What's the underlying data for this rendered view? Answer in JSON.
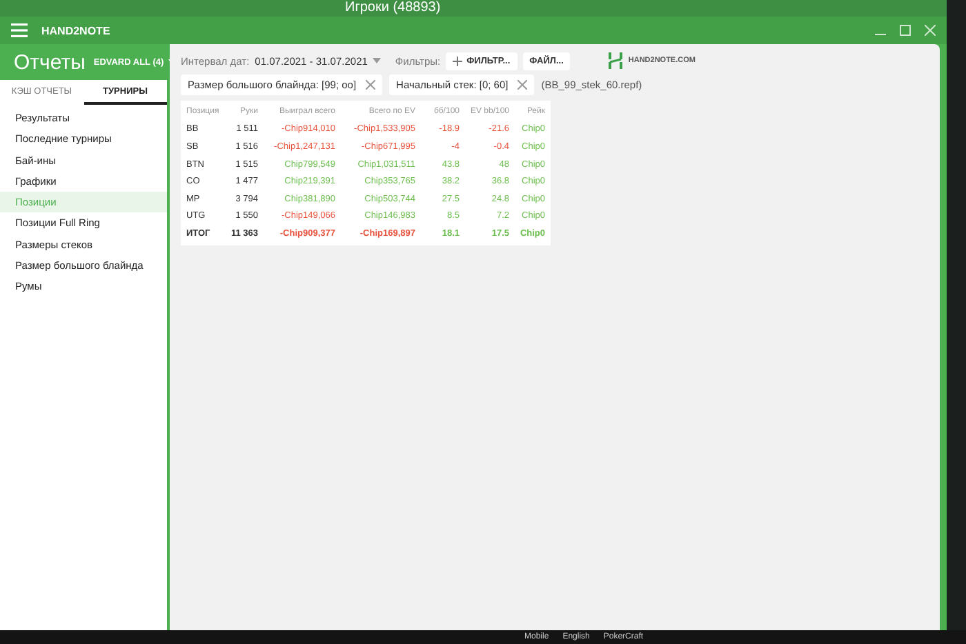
{
  "background_window": {
    "title": "Игроки (48893)"
  },
  "window": {
    "title": "HAND2NOTE"
  },
  "header": {
    "title": "Отчеты",
    "account": "EDVARD ALL (4)"
  },
  "tabs": [
    {
      "label": "КЭШ ОТЧЕТЫ",
      "selected": false
    },
    {
      "label": "ТУРНИРЫ",
      "selected": true
    }
  ],
  "sidebar": {
    "items": [
      {
        "label": "Результаты",
        "selected": false
      },
      {
        "label": "Последние турниры",
        "selected": false
      },
      {
        "label": "Бай-ины",
        "selected": false
      },
      {
        "label": "Графики",
        "selected": false
      },
      {
        "label": "Позиции",
        "selected": true
      },
      {
        "label": "Позиции Full Ring",
        "selected": false
      },
      {
        "label": "Размеры стеков",
        "selected": false
      },
      {
        "label": "Размер большого блайнда",
        "selected": false
      },
      {
        "label": "Румы",
        "selected": false
      }
    ]
  },
  "toolbar": {
    "date_label": "Интервал дат:",
    "date_value": "01.07.2021 - 31.07.2021",
    "filters_label": "Фильтры:",
    "filter_button": "ФИЛЬТР...",
    "file_button": "ФАЙЛ...",
    "logo_text": "HAND2NOTE.COM"
  },
  "active_filters": [
    {
      "label": "Размер большого блайнда: [99; oo]"
    },
    {
      "label": "Начальный стек: [0; 60]"
    }
  ],
  "filter_file": "(BB_99_stek_60.repf)",
  "table": {
    "columns": [
      "Позиция",
      "Руки",
      "Выиграл всего",
      "Всего по EV",
      "бб/100",
      "EV bb/100",
      "Рейк"
    ],
    "rows": [
      {
        "kind": "row",
        "cells": [
          {
            "text": "BB"
          },
          {
            "text": "1 511"
          },
          {
            "text": "-Chip914,010",
            "color": "#e8533c"
          },
          {
            "text": "-Chip1,533,905",
            "color": "#e8533c"
          },
          {
            "text": "-18.9",
            "color": "#e8533c"
          },
          {
            "text": "-21.6",
            "color": "#e8533c"
          },
          {
            "text": "Chip0",
            "color": "#6cbf4e"
          }
        ]
      },
      {
        "kind": "row",
        "cells": [
          {
            "text": "SB"
          },
          {
            "text": "1 516"
          },
          {
            "text": "-Chip1,247,131",
            "color": "#e8533c"
          },
          {
            "text": "-Chip671,995",
            "color": "#e8533c"
          },
          {
            "text": "-4",
            "color": "#e8533c"
          },
          {
            "text": "-0.4",
            "color": "#e8533c"
          },
          {
            "text": "Chip0",
            "color": "#6cbf4e"
          }
        ]
      },
      {
        "kind": "row",
        "cells": [
          {
            "text": "BTN"
          },
          {
            "text": "1 515"
          },
          {
            "text": "Chip799,549",
            "color": "#6cbf4e"
          },
          {
            "text": "Chip1,031,511",
            "color": "#6cbf4e"
          },
          {
            "text": "43.8",
            "color": "#6cbf4e"
          },
          {
            "text": "48",
            "color": "#6cbf4e"
          },
          {
            "text": "Chip0",
            "color": "#6cbf4e"
          }
        ]
      },
      {
        "kind": "row",
        "cells": [
          {
            "text": "CO"
          },
          {
            "text": "1 477"
          },
          {
            "text": "Chip219,391",
            "color": "#6cbf4e"
          },
          {
            "text": "Chip353,765",
            "color": "#6cbf4e"
          },
          {
            "text": "38.2",
            "color": "#6cbf4e"
          },
          {
            "text": "36.8",
            "color": "#6cbf4e"
          },
          {
            "text": "Chip0",
            "color": "#6cbf4e"
          }
        ]
      },
      {
        "kind": "row",
        "cells": [
          {
            "text": "MP"
          },
          {
            "text": "3 794"
          },
          {
            "text": "Chip381,890",
            "color": "#6cbf4e"
          },
          {
            "text": "Chip503,744",
            "color": "#6cbf4e"
          },
          {
            "text": "27.5",
            "color": "#6cbf4e"
          },
          {
            "text": "24.8",
            "color": "#6cbf4e"
          },
          {
            "text": "Chip0",
            "color": "#6cbf4e"
          }
        ]
      },
      {
        "kind": "row",
        "cells": [
          {
            "text": "UTG"
          },
          {
            "text": "1 550"
          },
          {
            "text": "-Chip149,066",
            "color": "#e8533c"
          },
          {
            "text": "Chip146,983",
            "color": "#6cbf4e"
          },
          {
            "text": "8.5",
            "color": "#6cbf4e"
          },
          {
            "text": "7.2",
            "color": "#6cbf4e"
          },
          {
            "text": "Chip0",
            "color": "#6cbf4e"
          }
        ]
      },
      {
        "kind": "total",
        "cells": [
          {
            "text": "ИТОГ"
          },
          {
            "text": "11 363"
          },
          {
            "text": "-Chip909,377",
            "color": "#e8533c"
          },
          {
            "text": "-Chip169,897",
            "color": "#e8533c"
          },
          {
            "text": "18.1",
            "color": "#6cbf4e"
          },
          {
            "text": "17.5",
            "color": "#6cbf4e"
          },
          {
            "text": "Chip0",
            "color": "#6cbf4e"
          }
        ]
      }
    ]
  },
  "taskbar": {
    "items": [
      "Mobile",
      "English",
      "PokerCraft"
    ]
  }
}
